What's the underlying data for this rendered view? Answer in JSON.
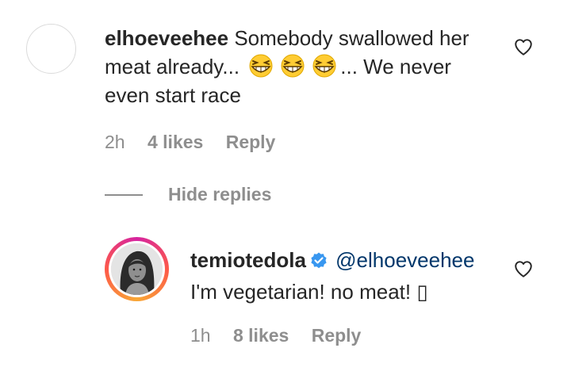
{
  "comment": {
    "username": "elhoeveehee",
    "text_part1": " Somebody swallowed her meat already... ",
    "emoji_count": 3,
    "text_part2": "... We never even start race",
    "time": "2h",
    "likes": "4 likes",
    "reply_label": "Reply",
    "emoji_name": "grinning-squinting-face-emoji"
  },
  "hide_replies": {
    "label": "Hide replies"
  },
  "reply": {
    "username": "temiotedola",
    "verified": true,
    "mention": "@elhoeveehee",
    "text": "I'm vegetarian! no meat! ▯",
    "time": "1h",
    "likes": "8 likes",
    "reply_label": "Reply"
  },
  "colors": {
    "text": "#262626",
    "secondary": "#8e8e8e",
    "verified_blue": "#3897f0",
    "mention": "#00376b"
  },
  "icons": {
    "like": "heart-outline-icon",
    "verified": "verified-badge-icon"
  }
}
